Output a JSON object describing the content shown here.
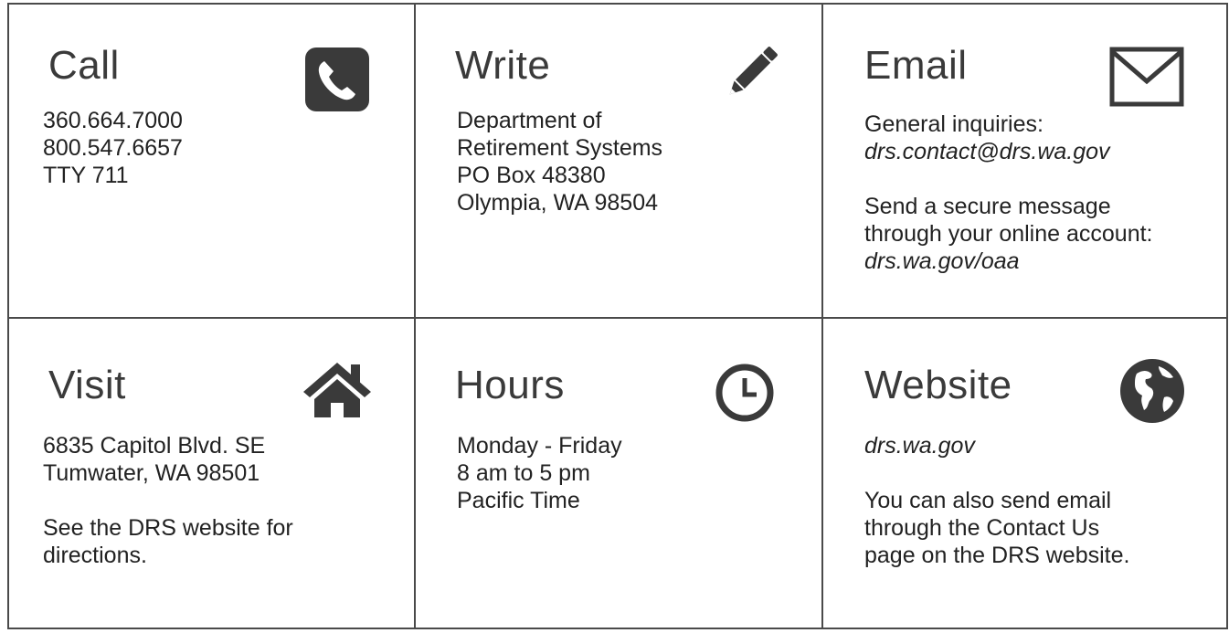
{
  "cells": {
    "call": {
      "title": "Call",
      "icon": "phone-icon",
      "lines": [
        "360.664.7000",
        "800.547.6657",
        "TTY  711"
      ]
    },
    "write": {
      "title": "Write",
      "icon": "pencil-icon",
      "lines": [
        "Department of",
        "Retirement Systems",
        "PO Box 48380",
        "Olympia, WA  98504"
      ]
    },
    "email": {
      "title": "Email",
      "icon": "envelope-icon",
      "inquiries_label": "General inquiries:",
      "inquiries_address": "drs.contact@drs.wa.gov",
      "secure_line1": "Send a secure message",
      "secure_line2": "through your online account:",
      "secure_address": "drs.wa.gov/oaa"
    },
    "visit": {
      "title": "Visit",
      "icon": "home-icon",
      "address_line1": "6835 Capitol Blvd. SE",
      "address_line2": "Tumwater, WA  98501",
      "note_line1": "See the DRS website for",
      "note_line2": "directions."
    },
    "hours": {
      "title": "Hours",
      "icon": "clock-icon",
      "lines": [
        "Monday - Friday",
        "8 am to 5 pm",
        "Pacific Time"
      ]
    },
    "website": {
      "title": "Website",
      "icon": "globe-icon",
      "url": "drs.wa.gov",
      "note_line1": "You can also send email",
      "note_line2": "through the Contact Us",
      "note_line3": "page on the DRS website."
    }
  },
  "colors": {
    "border": "#4a4a4a",
    "icon": "#3a3a3a",
    "text": "#222222"
  }
}
